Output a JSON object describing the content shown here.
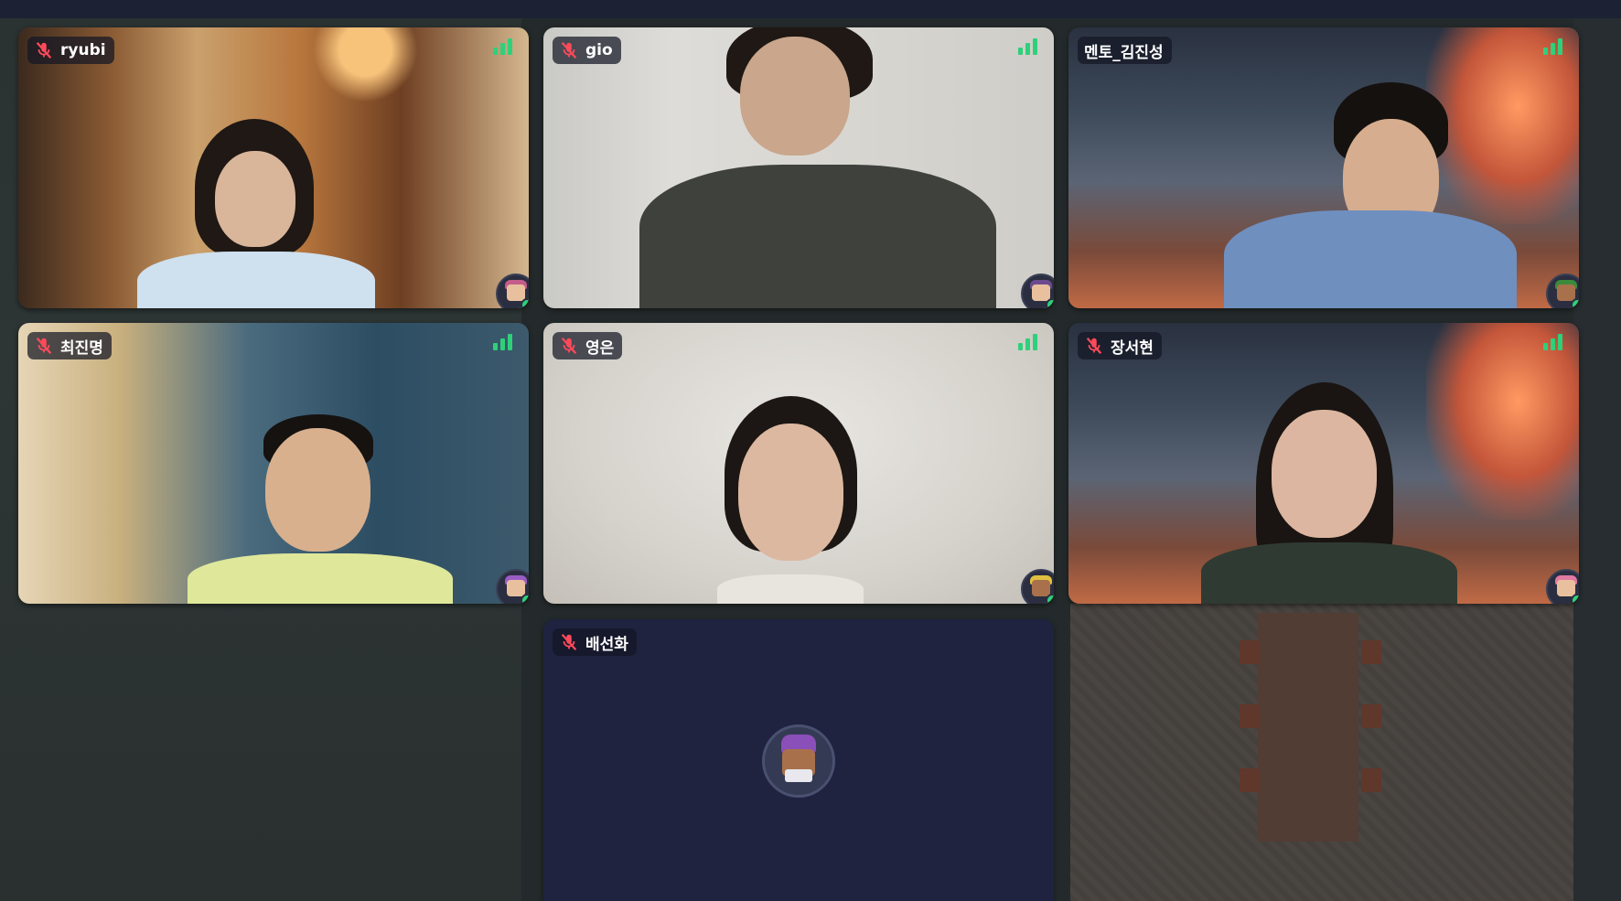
{
  "participants": [
    {
      "name": "ryubi",
      "mic": "muted",
      "scene": "cafe",
      "avatar_color": "#c45c8a"
    },
    {
      "name": "gio",
      "mic": "muted",
      "scene": "white-wall",
      "avatar_color": "#6b4a8e"
    },
    {
      "name": "멘토_김진성",
      "mic": "on",
      "scene": "workshop",
      "avatar_color": "#3c8a3c"
    },
    {
      "name": "최진명",
      "mic": "muted",
      "scene": "office",
      "avatar_color": "#9a5cc4"
    },
    {
      "name": "영은",
      "mic": "muted",
      "scene": "blurred",
      "avatar_color": "#e0c040"
    },
    {
      "name": "장서현",
      "mic": "muted",
      "scene": "workshop",
      "avatar_color": "#e07aa0"
    },
    {
      "name": "배선화",
      "mic": "muted",
      "scene": "camera-off",
      "avatar_color": "#8a4fb8"
    }
  ],
  "colors": {
    "signal": "#2fd07a",
    "mic_muted": "#ff4a5a",
    "tile_dark": "#1f2340"
  },
  "icons": {
    "mic_muted": "mic-off-icon",
    "connection": "signal-bars-icon",
    "online": "online-status-icon"
  }
}
